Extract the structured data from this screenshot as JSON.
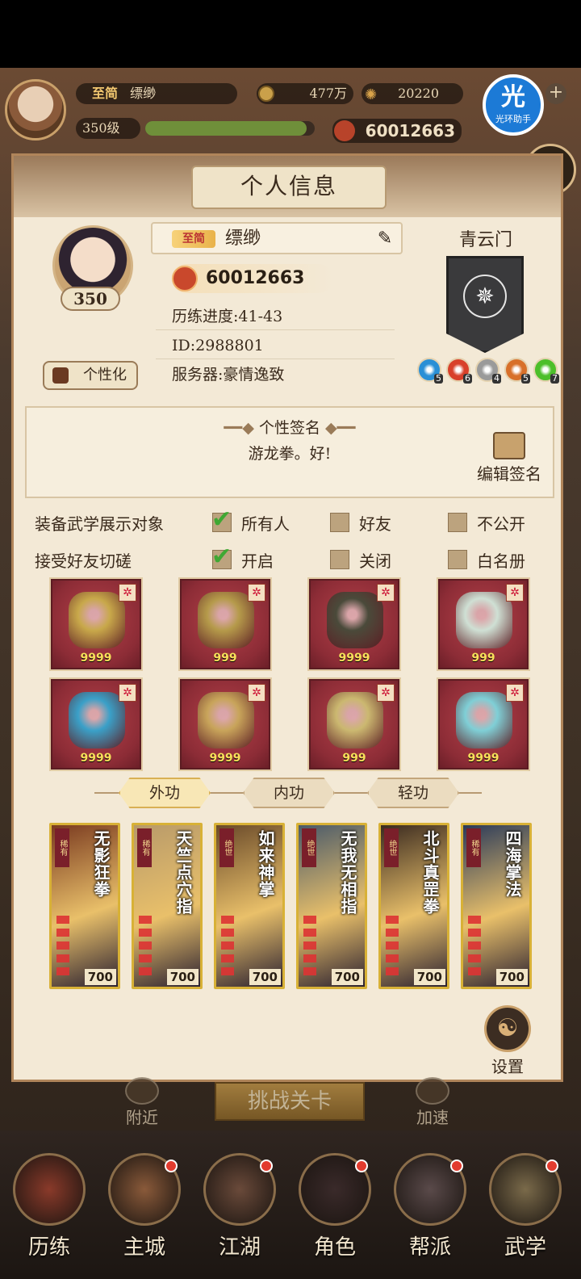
{
  "hud": {
    "vip_badge": "至简",
    "player_name": "缥缈",
    "level_text": "350级",
    "level_progress": 0.95,
    "coins": "477万",
    "ingots": "20220",
    "power": "60012663",
    "assistant_big": "光",
    "assistant_small": "光环助手",
    "chat_icon": "chat-bubble-icon"
  },
  "panel": {
    "title": "个人信息",
    "level": "350",
    "customize_label": "个性化",
    "vip_badge": "至简",
    "name": "缥缈",
    "power": "60012663",
    "progress_line": "历练进度:41-43",
    "id_line": "ID:2988801",
    "server_line": "服务器:豪情逸致",
    "sect": "青云门",
    "sect_skills": [
      {
        "level": "5",
        "color": "#2a8fd6"
      },
      {
        "level": "6",
        "color": "#d8402a"
      },
      {
        "level": "4",
        "color": "#9a9a9a"
      },
      {
        "level": "5",
        "color": "#d8702a"
      },
      {
        "level": "7",
        "color": "#4cbf2a"
      }
    ],
    "signature": {
      "title": "个性签名",
      "text": "游龙拳。好!",
      "edit_label": "编辑签名"
    },
    "options": [
      {
        "label": "装备武学展示对象",
        "choices": [
          {
            "label": "所有人",
            "checked": true
          },
          {
            "label": "好友",
            "checked": false
          },
          {
            "label": "不公开",
            "checked": false
          }
        ]
      },
      {
        "label": "接受好友切磋",
        "choices": [
          {
            "label": "开启",
            "checked": true
          },
          {
            "label": "关闭",
            "checked": false
          },
          {
            "label": "白名册",
            "checked": false
          }
        ]
      }
    ],
    "equipment": [
      {
        "name": "bracer-item",
        "count": "9999",
        "color": "#c8a84a"
      },
      {
        "name": "armor-item",
        "count": "999",
        "color": "#b59a4a"
      },
      {
        "name": "belt-item",
        "count": "9999",
        "color": "#4a4a3a"
      },
      {
        "name": "boots-item",
        "count": "999",
        "color": "#cfe0d4"
      },
      {
        "name": "necklace-item",
        "count": "9999",
        "color": "#3aa0c8"
      },
      {
        "name": "hairpin-item",
        "count": "9999",
        "color": "#c8a45a"
      },
      {
        "name": "bangle-item",
        "count": "999",
        "color": "#cbb870"
      },
      {
        "name": "ring-item",
        "count": "9999",
        "color": "#7fcfd6"
      }
    ],
    "tabs": [
      "外功",
      "内功",
      "轻功"
    ],
    "active_tab": 0,
    "kungfu": [
      {
        "name": "无影狂拳",
        "rank": "稀有",
        "power": "700"
      },
      {
        "name": "天竺点穴指",
        "rank": "稀有",
        "power": "700"
      },
      {
        "name": "如来神掌",
        "rank": "绝世",
        "power": "700"
      },
      {
        "name": "无我无相指",
        "rank": "绝世",
        "power": "700"
      },
      {
        "name": "北斗真罡拳",
        "rank": "绝世",
        "power": "700"
      },
      {
        "name": "四海掌法",
        "rank": "稀有",
        "power": "700"
      }
    ],
    "settings_label": "设置"
  },
  "bottom": {
    "challenge": "挑战关卡",
    "nearby": "附近",
    "speedup": "加速",
    "nav": [
      {
        "label": "历练",
        "dot": false
      },
      {
        "label": "主城",
        "dot": true
      },
      {
        "label": "江湖",
        "dot": true
      },
      {
        "label": "角色",
        "dot": true
      },
      {
        "label": "帮派",
        "dot": true
      },
      {
        "label": "武学",
        "dot": true
      }
    ]
  }
}
